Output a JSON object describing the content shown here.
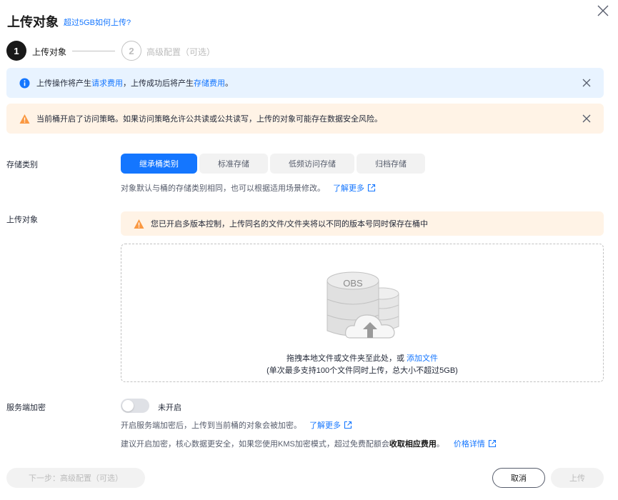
{
  "header": {
    "title": "上传对象",
    "help_link": "超过5GB如何上传?"
  },
  "steps": [
    {
      "number": "1",
      "label": "上传对象"
    },
    {
      "number": "2",
      "label": "高级配置（可选）"
    }
  ],
  "info_banner": {
    "text_before": "上传操作将产生",
    "link1": "请求费用",
    "text_middle": "，上传成功后将产生",
    "link2": "存储费用",
    "text_after": "。"
  },
  "warn_banner": {
    "text": "当前桶开启了访问策略。如果访问策略允许公共读或公共读写，上传的对象可能存在数据安全风险。"
  },
  "storage_class": {
    "label": "存储类别",
    "options": [
      "继承桶类别",
      "标准存储",
      "低频访问存储",
      "归档存储"
    ],
    "selected": "继承桶类别",
    "hint": "对象默认与桶的存储类别相同，也可以根据适用场景修改。",
    "learn_more": "了解更多"
  },
  "upload": {
    "label": "上传对象",
    "version_warning": "您已开启多版本控制，上传同名的文件/文件夹将以不同的版本号同时保存在桶中",
    "illustration_text": "OBS",
    "drop_text": "拖拽本地文件或文件夹至此处，或",
    "add_file_link": "添加文件",
    "limit_text": "(单次最多支持100个文件同时上传，总大小不超过5GB)"
  },
  "encryption": {
    "label": "服务端加密",
    "toggle_state": "未开启",
    "hint1": "开启服务端加密后，上传到当前桶的对象会被加密。",
    "learn_more": "了解更多",
    "hint2_before": "建议开启加密，核心数据更安全，如果您使用KMS加密模式，超过免费配额会",
    "hint2_bold": "收取相应费用",
    "hint2_after": "。",
    "price_link": "价格详情"
  },
  "footer": {
    "next_button": "下一步：高级配置（可选）",
    "cancel_button": "取消",
    "upload_button": "上传"
  },
  "colors": {
    "accent": "#1476ff",
    "info_bg": "#e8f3ff",
    "warn_bg": "#fff3e6",
    "warn_icon": "#fa9841"
  }
}
